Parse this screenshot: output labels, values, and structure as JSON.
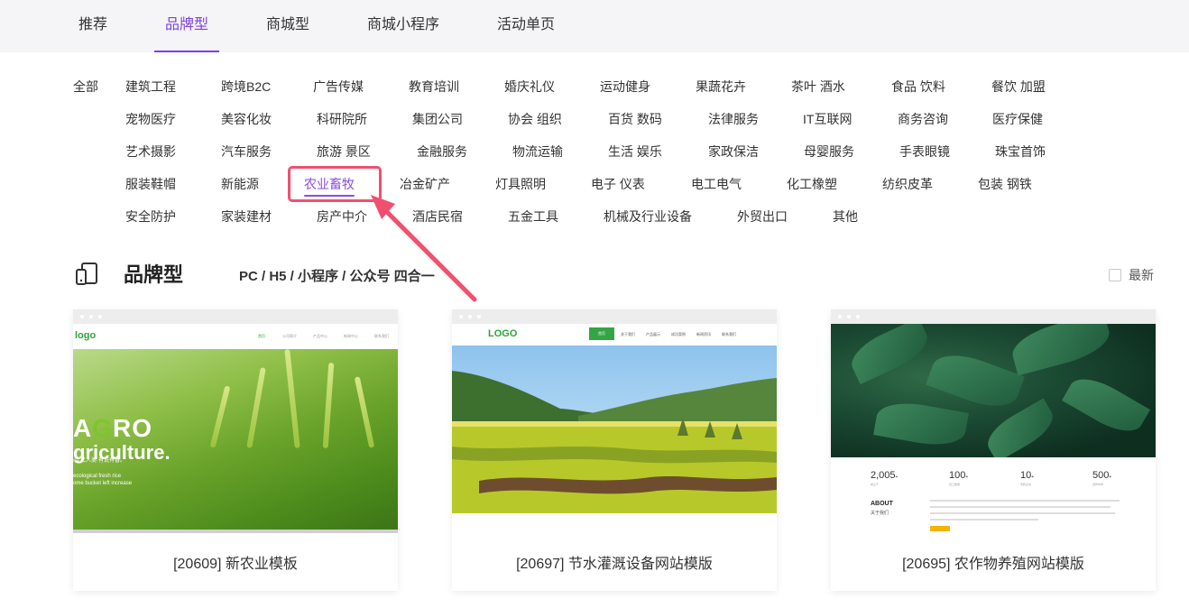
{
  "tabs": [
    {
      "label": "推荐"
    },
    {
      "label": "品牌型"
    },
    {
      "label": "商城型"
    },
    {
      "label": "商城小程序"
    },
    {
      "label": "活动单页"
    }
  ],
  "categories": {
    "all": "全部",
    "rows": [
      [
        "建筑工程",
        "跨境B2C",
        "广告传媒",
        "教育培训",
        "婚庆礼仪",
        "运动健身",
        "果蔬花卉",
        "茶叶 酒水",
        "食品 饮料",
        "餐饮 加盟"
      ],
      [
        "宠物医疗",
        "美容化妆",
        "科研院所",
        "集团公司",
        "协会 组织",
        "百货 数码",
        "法律服务",
        "IT互联网",
        "商务咨询",
        "医疗保健"
      ],
      [
        "艺术摄影",
        "汽车服务",
        "旅游 景区",
        "金融服务",
        "物流运输",
        "生活 娱乐",
        "家政保洁",
        "母婴服务",
        "手表眼镜",
        "珠宝首饰"
      ],
      [
        "服装鞋帽",
        "新能源",
        "农业畜牧",
        "冶金矿产",
        "灯具照明",
        "电子 仪表",
        "电工电气",
        "化工橡塑",
        "纺织皮革",
        "包装 钢铁"
      ],
      [
        "安全防护",
        "家装建材",
        "房产中介",
        "酒店民宿",
        "五金工具",
        "机械及行业设备",
        "外贸出口",
        "其他"
      ]
    ]
  },
  "section": {
    "title": "品牌型",
    "subtitle": "PC / H5 / 小程序 / 公众号 四合一",
    "sort_label": "最新"
  },
  "cards": [
    {
      "caption": "[20609] 新农业模板",
      "logo": "logo",
      "menu": [
        "首页",
        "公司简介",
        "产品中心",
        "新闻中心",
        "联系我们"
      ],
      "headline_a": "A",
      "headline_g": "G",
      "headline_rest": "RO",
      "subline": "griculture.",
      "tag1": "心·又人美·有说有香。",
      "tag2": "ecological fresh rice",
      "tag3": "ome bucket left increase"
    },
    {
      "caption": "[20697] 节水灌溉设备网站模版",
      "logo": "LOGO",
      "home": "首页",
      "menu": [
        "关于我们",
        "产品展示",
        "成功案例",
        "新闻资讯",
        "联系我们"
      ]
    },
    {
      "caption": "[20695] 农作物养殖网站模版",
      "stats": [
        {
          "num": "2,005",
          "unit": "+",
          "label": "成立于"
        },
        {
          "num": "100",
          "unit": "+",
          "label": "员工数量"
        },
        {
          "num": "10",
          "unit": "+",
          "label": "专利证书"
        },
        {
          "num": "500",
          "unit": "+",
          "label": "合作伙伴"
        }
      ],
      "about": "ABOUT",
      "about_cn": "关于我们"
    }
  ],
  "colors": {
    "accent": "#7b3fe4",
    "highlight": "#f0506e",
    "green": "#2ea43a"
  }
}
